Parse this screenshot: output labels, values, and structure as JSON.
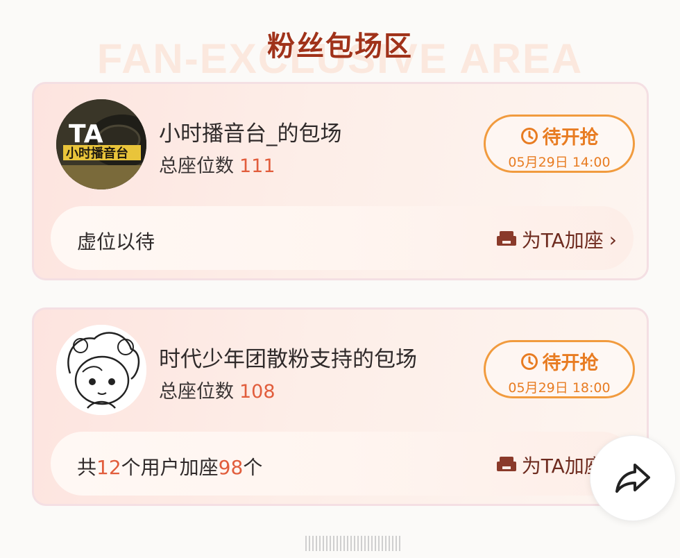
{
  "header": {
    "title": "粉丝包场区",
    "background_text": "FAN-EXCLUSIVE AREA"
  },
  "cards": [
    {
      "title": "小时播音台_的包场",
      "seats_label": "总座位数",
      "seats_count": "111",
      "status": {
        "label": "待开抢",
        "datetime": "05月29日 14:00",
        "icon": "clock-icon"
      },
      "footer": {
        "text": "虚位以待",
        "add_seat_label": "为TA加座",
        "icon": "sofa-icon"
      }
    },
    {
      "title": "时代少年团散粉支持的包场",
      "seats_label": "总座位数",
      "seats_count": "108",
      "status": {
        "label": "待开抢",
        "datetime": "05月29日 18:00",
        "icon": "clock-icon"
      },
      "footer": {
        "prefix": "共",
        "user_count": "12",
        "middle": "个用户加座",
        "seat_count": "98",
        "suffix": "个",
        "add_seat_label": "为TA加座",
        "icon": "sofa-icon"
      }
    }
  ],
  "fab": {
    "icon": "share-icon"
  },
  "colors": {
    "title": "#a0321a",
    "accent_orange": "#f19b3e",
    "highlight_red": "#e15d3c",
    "add_seat_brown": "#6e2b1f"
  }
}
